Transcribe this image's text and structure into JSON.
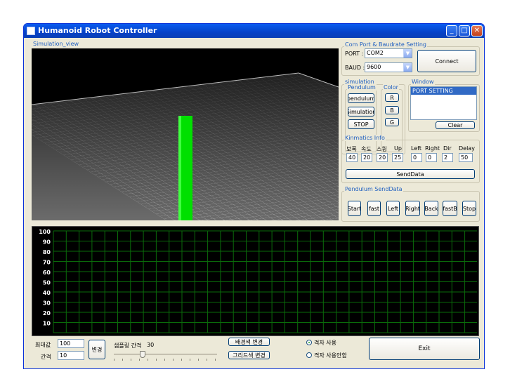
{
  "window": {
    "title": "Humanoid Robot Controller",
    "min_glyph": "_",
    "max_glyph": "□",
    "close_glyph": "✕"
  },
  "simulation_view": {
    "label": "Simulation_view"
  },
  "com_port": {
    "label": "Com Port & Baudrate Setting",
    "port_label": "PORT :",
    "port_value": "COM2",
    "baud_label": "BAUD :",
    "baud_value": "9600",
    "connect_label": "Connect"
  },
  "simulation": {
    "label": "simulation",
    "pendulum_group": "Pendulum",
    "color_group": "Color",
    "pendulum_btn": "pendulum",
    "simulation_btn": "Simulation",
    "stop_btn": "STOP",
    "r_btn": "R",
    "b_btn": "B",
    "g_btn": "G"
  },
  "window_panel": {
    "label": "Window",
    "items": [
      "PORT SETTING"
    ],
    "clear_label": "Clear"
  },
  "kinematics": {
    "label": "Kinmatics Info",
    "headers": [
      "보폭",
      "속도",
      "스윙",
      "Up",
      "Left",
      "Right",
      "Dir",
      "Delay"
    ],
    "values": [
      "40",
      "20",
      "20",
      "25",
      "0",
      "0",
      "2",
      "50"
    ],
    "send_label": "SendData"
  },
  "pendulum_send": {
    "label": "Pendulum SendData",
    "buttons": [
      "Start",
      "fast",
      "Left",
      "Right",
      "Back",
      "fastB",
      "Stop"
    ]
  },
  "graph": {
    "y_ticks": [
      "100",
      "90",
      "80",
      "70",
      "60",
      "50",
      "40",
      "30",
      "20",
      "10"
    ]
  },
  "bottom": {
    "max_label": "최대값",
    "max_value": "100",
    "interval_label": "간격",
    "interval_value": "10",
    "change_label": "변경",
    "sampling_label": "샘플링 간격",
    "sampling_value": "30",
    "bg_color_btn": "배경색 변경",
    "grid_color_btn": "그리드색 변경",
    "grid_use": "격자 사용",
    "grid_no_use": "격자 사용안함",
    "exit_label": "Exit"
  },
  "colors": {
    "accent": "#1f5fc1",
    "pendulum": "#00e000",
    "graph_grid": "#0a6b0a"
  }
}
